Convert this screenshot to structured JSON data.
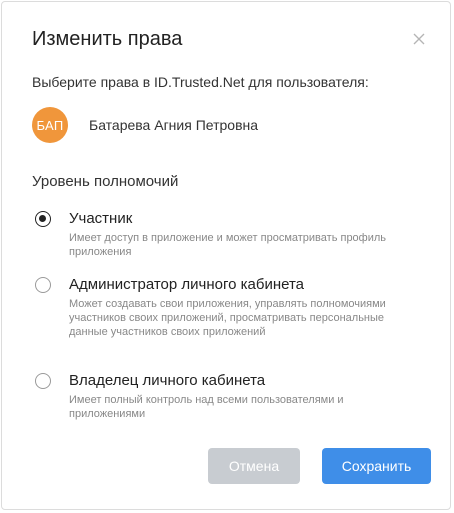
{
  "dialog": {
    "title": "Изменить права",
    "close_icon": "close-icon",
    "prompt": "Выберите права в ID.Trusted.Net для пользователя:"
  },
  "user": {
    "initials": "БАП",
    "name": "Батарева Агния Петровна",
    "avatar_color": "#f0963b"
  },
  "permissions": {
    "heading": "Уровень полномочий",
    "selected": "member",
    "options": [
      {
        "id": "member",
        "title": "Участник",
        "description": "Имеет доступ в приложение и может просматривать профиль приложения",
        "checked": true
      },
      {
        "id": "admin",
        "title": "Администратор личного кабинета",
        "description": "Может создавать свои приложения, управлять полномочиями участников своих приложений, просматривать персональные данные участников своих приложений",
        "checked": false
      },
      {
        "id": "owner",
        "title": "Владелец личного кабинета",
        "description": "Имеет полный контроль над всеми пользователями и приложениями",
        "checked": false
      }
    ]
  },
  "footer": {
    "cancel_label": "Отмена",
    "save_label": "Сохранить",
    "cancel_color": "#c8ccd1",
    "save_color": "#3f8ee8"
  }
}
